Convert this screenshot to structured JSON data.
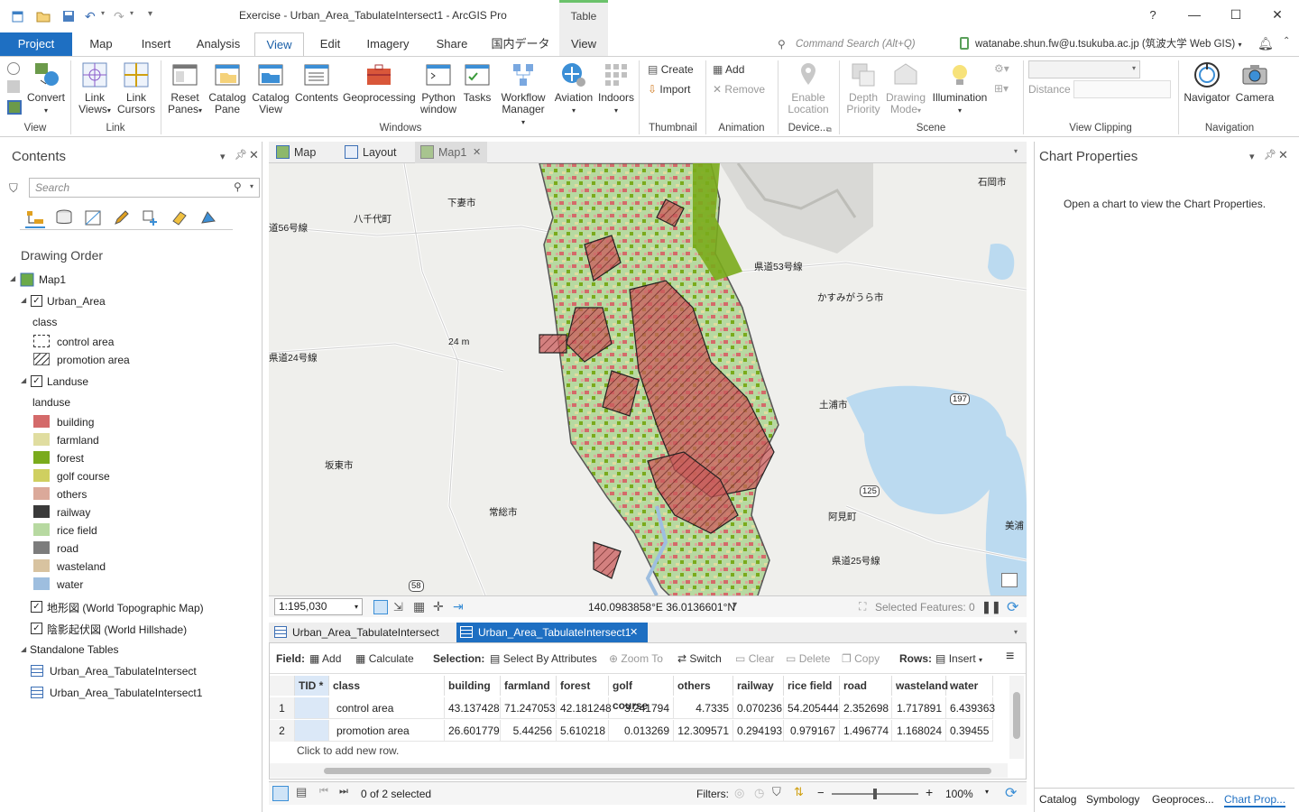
{
  "window": {
    "title": "Exercise - Urban_Area_TabulateIntersect1 - ArcGIS Pro",
    "context_group": "Table",
    "help": "?"
  },
  "tabs": [
    {
      "label": "Project"
    },
    {
      "label": "Map"
    },
    {
      "label": "Insert"
    },
    {
      "label": "Analysis"
    },
    {
      "label": "View"
    },
    {
      "label": "Edit"
    },
    {
      "label": "Imagery"
    },
    {
      "label": "Share"
    },
    {
      "label": "国内データ"
    },
    {
      "label": "View"
    }
  ],
  "command_search": {
    "placeholder": "Command Search (Alt+Q)"
  },
  "user": {
    "label": "watanabe.shun.fw@u.tsukuba.ac.jp (筑波大学 Web GIS)"
  },
  "ribbon": {
    "view_group": {
      "convert": "Convert",
      "label": "View"
    },
    "link_group": {
      "link_views": "Link Views",
      "link_cursors": "Link Cursors",
      "label": "Link"
    },
    "windows_group": {
      "reset_panes": "Reset Panes",
      "catalog_pane": "Catalog Pane",
      "catalog_view": "Catalog View",
      "contents": "Contents",
      "geoprocessing": "Geoprocessing",
      "python_window": "Python window",
      "tasks": "Tasks",
      "workflow_manager": "Workflow Manager",
      "aviation": "Aviation",
      "indoors": "Indoors",
      "label": "Windows"
    },
    "thumbnail_group": {
      "create": "Create",
      "import": "Import",
      "label": "Thumbnail"
    },
    "animation_group": {
      "add": "Add",
      "remove": "Remove",
      "label": "Animation"
    },
    "device_group": {
      "enable_location": "Enable Location",
      "label": "Device..."
    },
    "scene_group": {
      "depth_priority": "Depth Priority",
      "drawing_mode": "Drawing Mode",
      "illumination": "Illumination",
      "label": "Scene"
    },
    "view_clipping_group": {
      "distance": "Distance",
      "label": "View Clipping"
    },
    "navigation_group": {
      "navigator": "Navigator",
      "camera": "Camera",
      "label": "Navigation"
    }
  },
  "contents": {
    "title": "Contents",
    "search_placeholder": "Search",
    "drawing_order": "Drawing Order",
    "map_name": "Map1",
    "urban_area": {
      "name": "Urban_Area",
      "field": "class",
      "classes": [
        {
          "label": "control area"
        },
        {
          "label": "promotion area"
        }
      ]
    },
    "landuse": {
      "name": "Landuse",
      "field": "landuse",
      "classes": [
        {
          "label": "building",
          "color": "#d46a6a"
        },
        {
          "label": "farmland",
          "color": "#e0dda0"
        },
        {
          "label": "forest",
          "color": "#7aab1c"
        },
        {
          "label": "golf course",
          "color": "#cfcf60"
        },
        {
          "label": "others",
          "color": "#dba99a"
        },
        {
          "label": "railway",
          "color": "#3a3a3a"
        },
        {
          "label": "rice field",
          "color": "#b7d9a1"
        },
        {
          "label": "road",
          "color": "#7c7c7c"
        },
        {
          "label": "wasteland",
          "color": "#d8c3a0"
        },
        {
          "label": "water",
          "color": "#9ebedf"
        }
      ]
    },
    "basemaps": [
      {
        "label": "地形図 (World Topographic Map)"
      },
      {
        "label": "陰影起伏図 (World Hillshade)"
      }
    ],
    "standalone_tables": "Standalone Tables",
    "tables": [
      {
        "label": "Urban_Area_TabulateIntersect"
      },
      {
        "label": "Urban_Area_TabulateIntersect1"
      }
    ]
  },
  "view_tabs": [
    {
      "label": "Map"
    },
    {
      "label": "Layout"
    },
    {
      "label": "Map1"
    }
  ],
  "map": {
    "labels": [
      {
        "text": "下妻市"
      },
      {
        "text": "八千代町"
      },
      {
        "text": "石岡市"
      },
      {
        "text": "かすみがうら市"
      },
      {
        "text": "土浦市"
      },
      {
        "text": "坂東市"
      },
      {
        "text": "常総市"
      },
      {
        "text": "阿見町"
      },
      {
        "text": "美浦"
      },
      {
        "text": "24 m"
      },
      {
        "text": "県道56号線"
      },
      {
        "text": "道56号線"
      },
      {
        "text": "県道53号線"
      },
      {
        "text": "県道24号線"
      },
      {
        "text": "197"
      },
      {
        "text": "125"
      },
      {
        "text": "58"
      },
      {
        "text": "県道25号線"
      }
    ],
    "scale": "1:195,030",
    "coords": "140.0983858°E 36.0136601°N",
    "selected_features": "Selected Features: 0"
  },
  "table_tabs": [
    {
      "label": "Urban_Area_TabulateIntersect"
    },
    {
      "label": "Urban_Area_TabulateIntersect1"
    }
  ],
  "table_toolbar": {
    "field": "Field:",
    "add": "Add",
    "calculate": "Calculate",
    "selection": "Selection:",
    "select_by_attributes": "Select By Attributes",
    "zoom_to": "Zoom To",
    "switch": "Switch",
    "clear": "Clear",
    "delete": "Delete",
    "copy": "Copy",
    "rows": "Rows:",
    "insert": "Insert"
  },
  "table": {
    "columns": [
      "TID *",
      "class",
      "building",
      "farmland",
      "forest",
      "golf course",
      "others",
      "railway",
      "rice field",
      "road",
      "wasteland",
      "water"
    ],
    "rows": [
      {
        "n": "1",
        "cells": [
          "",
          "control area",
          "43.137428",
          "71.247053",
          "42.181248",
          "3.241794",
          "4.7335",
          "0.070236",
          "54.205444",
          "2.352698",
          "1.717891",
          "6.439363"
        ]
      },
      {
        "n": "2",
        "cells": [
          "",
          "promotion area",
          "26.601779",
          "5.44256",
          "5.610218",
          "0.013269",
          "12.309571",
          "0.294193",
          "0.979167",
          "1.496774",
          "1.168024",
          "0.39455"
        ]
      }
    ],
    "add_row": "Click to add new row."
  },
  "bottom": {
    "selected": "0 of 2 selected",
    "filters": "Filters:",
    "zoom": "100%"
  },
  "chart_properties": {
    "title": "Chart Properties",
    "message": "Open a chart to view the Chart Properties."
  },
  "right_tabs": [
    {
      "label": "Catalog"
    },
    {
      "label": "Symbology"
    },
    {
      "label": "Geoproces..."
    },
    {
      "label": "Chart Prop..."
    }
  ]
}
